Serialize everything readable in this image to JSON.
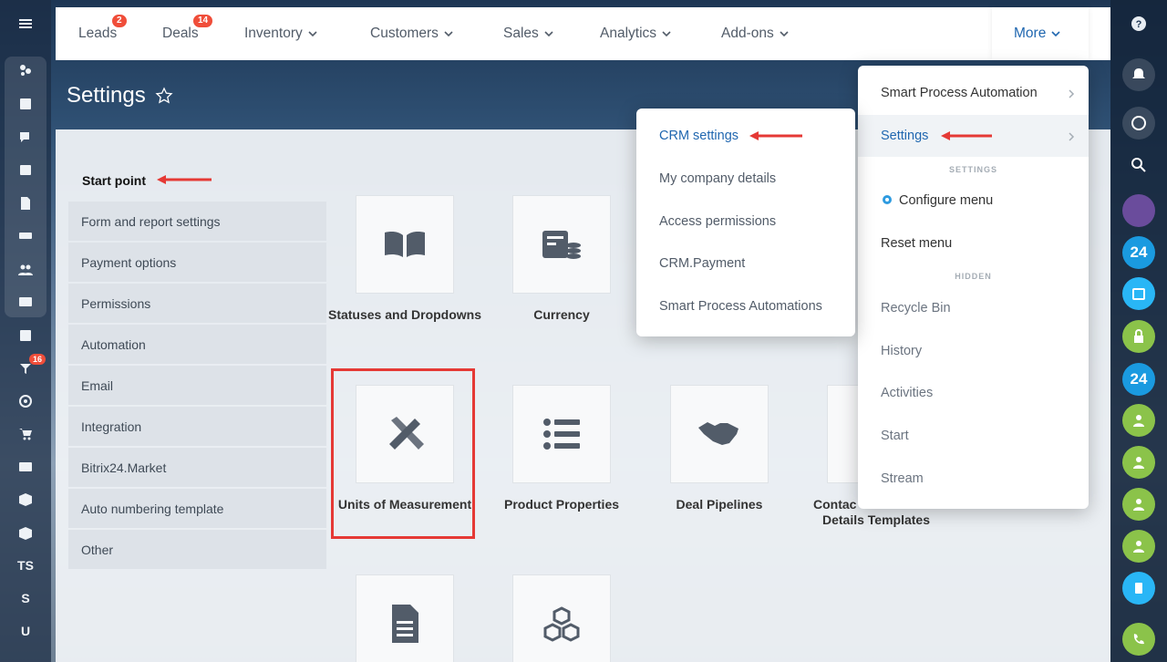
{
  "nav": {
    "items": [
      {
        "label": "Leads",
        "badge": "2"
      },
      {
        "label": "Deals",
        "badge": "14"
      },
      {
        "label": "Inventory"
      },
      {
        "label": "Customers"
      },
      {
        "label": "Sales"
      },
      {
        "label": "Analytics"
      },
      {
        "label": "Add-ons"
      }
    ],
    "more_label": "More"
  },
  "page": {
    "title": "Settings"
  },
  "left_bar": {
    "badge": "16",
    "letters": [
      "TS",
      "S",
      "U"
    ],
    "icons": [
      "hamburger-icon",
      "feed-icon",
      "tasks-icon",
      "chat-icon",
      "calendar-icon",
      "document-icon",
      "drive-icon",
      "employees-icon",
      "mail-icon",
      "checklist-icon",
      "crm-icon",
      "target-icon",
      "cart-icon",
      "contact-card-icon",
      "box-icon",
      "box-icon"
    ]
  },
  "right_bar": {
    "icons": [
      "help-icon",
      "bell-icon",
      "messenger-icon",
      "search-icon",
      "avatar",
      "bitrix24-icon",
      "calendar-icon",
      "lock-icon",
      "bitrix24-icon",
      "group-icon",
      "group-icon",
      "group-icon",
      "group-icon",
      "phone-transfer-icon",
      "call-icon"
    ],
    "label_24": "24"
  },
  "settings": {
    "start_point": "Start point",
    "side_items": [
      "Form and report settings",
      "Payment options",
      "Permissions",
      "Automation",
      "Email",
      "Integration",
      "Bitrix24.Market",
      "Auto numbering template",
      "Other"
    ],
    "tiles": [
      {
        "label": "Statuses and Dropdowns",
        "icon": "book-icon"
      },
      {
        "label": "Currency",
        "icon": "currency-icon"
      },
      {
        "label": "Units of Measurement",
        "icon": "ruler-pencil-icon"
      },
      {
        "label": "Product Properties",
        "icon": "list-icon"
      },
      {
        "label": "Deal Pipelines",
        "icon": "handshake-icon"
      },
      {
        "label": "Contact  Company Details Templates",
        "label_line1": "Contac",
        "label_line2": "Details Templates",
        "icon": "template-icon"
      },
      {
        "label": "",
        "icon": "document-icon"
      },
      {
        "label": "",
        "icon": "cubes-icon"
      }
    ]
  },
  "menu_more": {
    "items": [
      {
        "label": "Smart Process Automation",
        "submenu": true
      },
      {
        "label": "Settings",
        "submenu": true,
        "active": true
      }
    ],
    "section_settings": "SETTINGS",
    "configure": "Configure menu",
    "reset": "Reset menu",
    "section_hidden": "HIDDEN",
    "hidden_items": [
      "Recycle Bin",
      "History",
      "Activities",
      "Start",
      "Stream"
    ]
  },
  "menu_crm": {
    "items": [
      "CRM settings",
      "My company details",
      "Access permissions",
      "CRM.Payment",
      "Smart Process Automations"
    ]
  },
  "colors": {
    "accent": "#2067b0",
    "badge": "#f04e3a",
    "highlight": "#e53935"
  }
}
